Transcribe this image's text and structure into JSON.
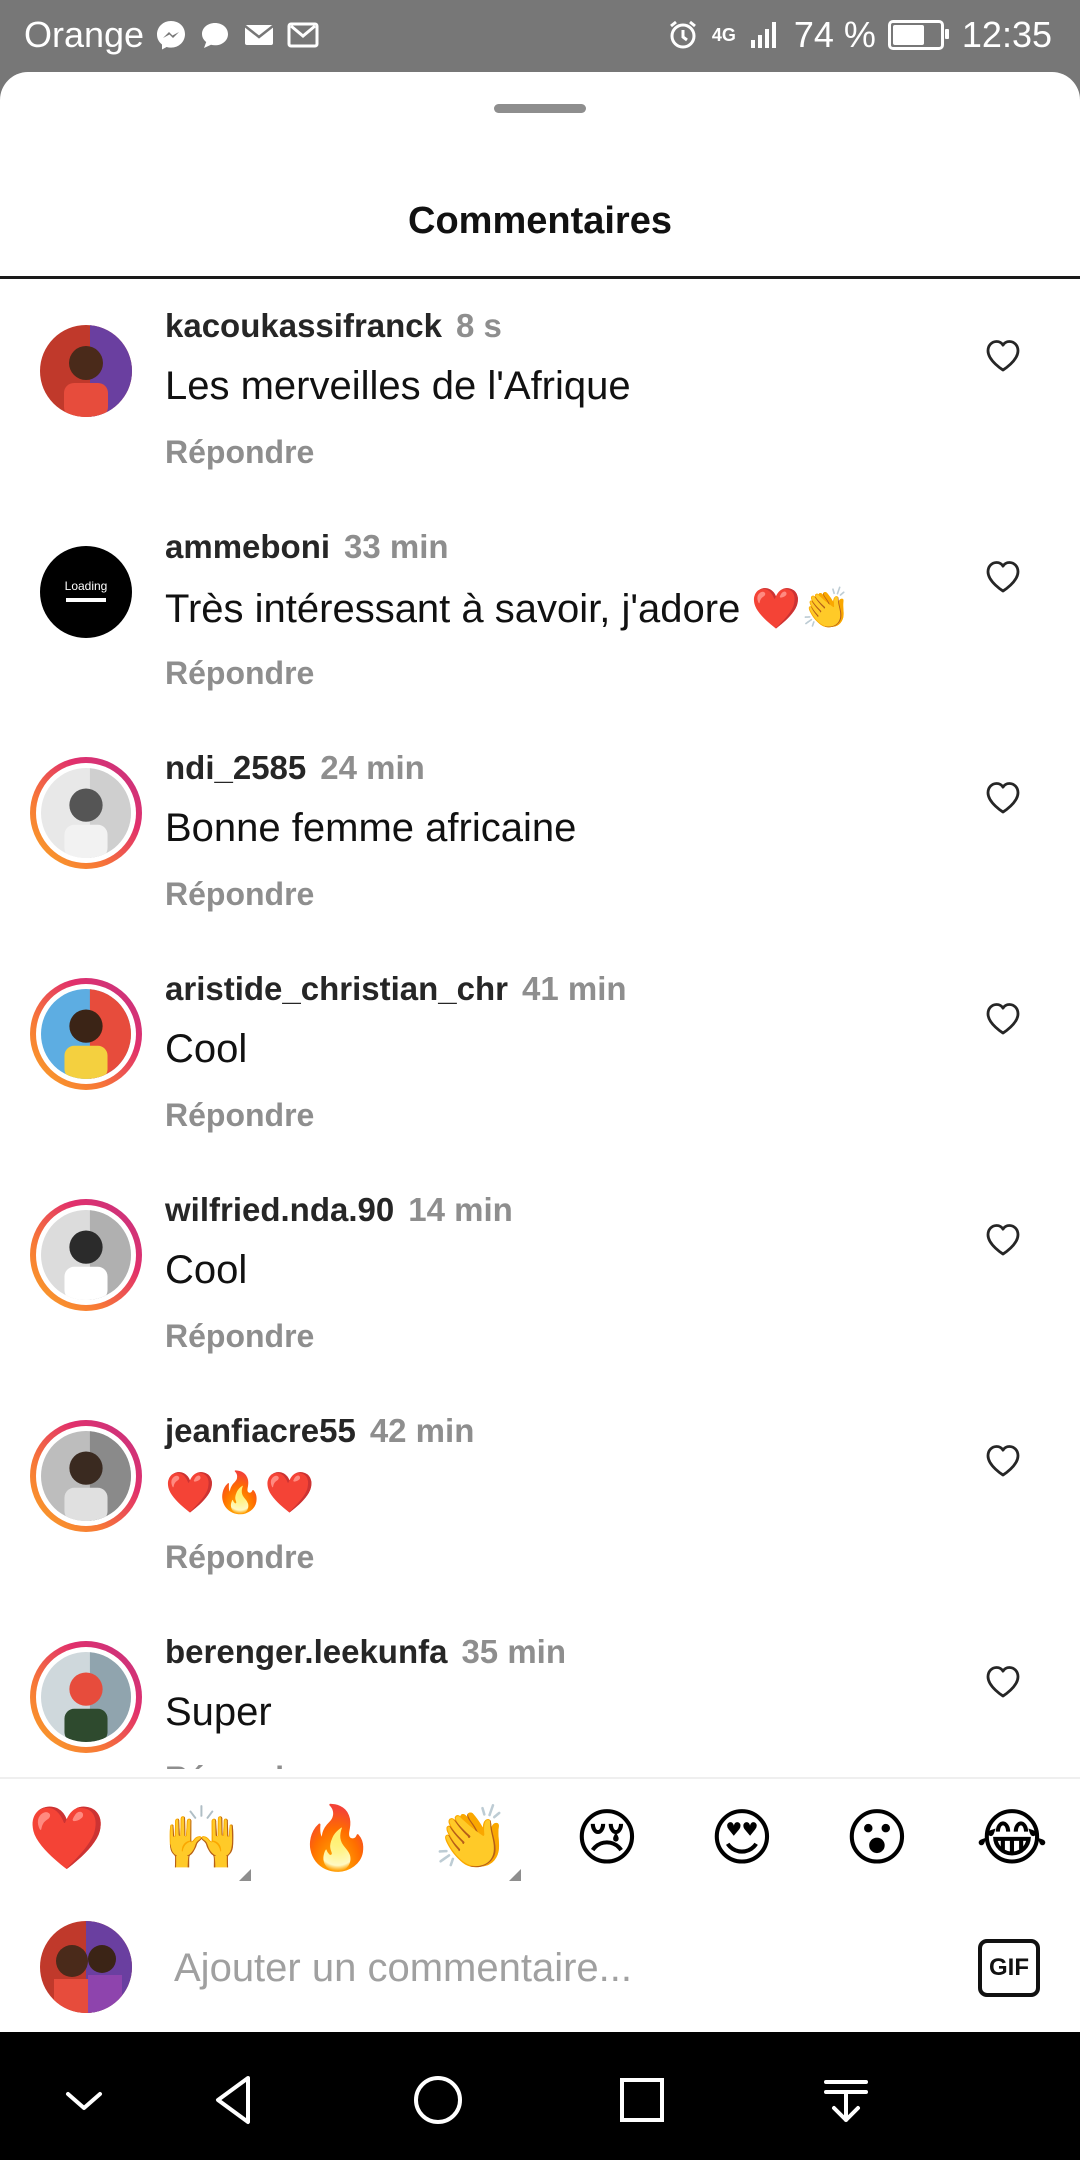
{
  "status_bar": {
    "carrier": "Orange",
    "network": "4G",
    "battery_percent": "74 %",
    "battery_level": 0.74,
    "time": "12:35",
    "notification_icons": [
      "messenger-icon",
      "chat-icon",
      "mail-icon",
      "gmail-icon"
    ]
  },
  "sheet": {
    "title": "Commentaires"
  },
  "comments": [
    {
      "user": "kacoukassifranck",
      "time": "8 s",
      "text": "Les merveilles de l'Afrique",
      "reply": "Répondre",
      "ring": false
    },
    {
      "user": "ammeboni",
      "time": "33 min",
      "text": "Très intéressant à savoir, j'adore ❤️👏",
      "reply": "Répondre",
      "ring": false,
      "avatar_text": "Loading"
    },
    {
      "user": "ndi_2585",
      "time": "24 min",
      "text": "Bonne femme africaine",
      "reply": "Répondre",
      "ring": true
    },
    {
      "user": "aristide_christian_chr",
      "time": "41 min",
      "text": "Cool",
      "reply": "Répondre",
      "ring": true
    },
    {
      "user": "wilfried.nda.90",
      "time": "14 min",
      "text": "Cool",
      "reply": "Répondre",
      "ring": true
    },
    {
      "user": "jeanfiacre55",
      "time": "42 min",
      "text": "❤️🔥❤️",
      "reply": "Répondre",
      "ring": true
    },
    {
      "user": "berenger.leekunfa",
      "time": "35 min",
      "text": "Super",
      "reply": "Répondre",
      "ring": true
    }
  ],
  "quick_reactions": [
    "❤️",
    "🙌",
    "🔥",
    "👏",
    "😢",
    "😍",
    "😮",
    "😂"
  ],
  "composer": {
    "placeholder": "Ajouter un commentaire...",
    "gif_label": "GIF"
  },
  "nav_bar": [
    "chevron-down-icon",
    "back-icon",
    "home-icon",
    "recents-icon",
    "download-icon"
  ],
  "colors": {
    "status_bar_bg": "#777777",
    "secondary_text": "#8e8e8e",
    "story_ring_start": "#f9a825",
    "story_ring_end": "#c13584"
  }
}
